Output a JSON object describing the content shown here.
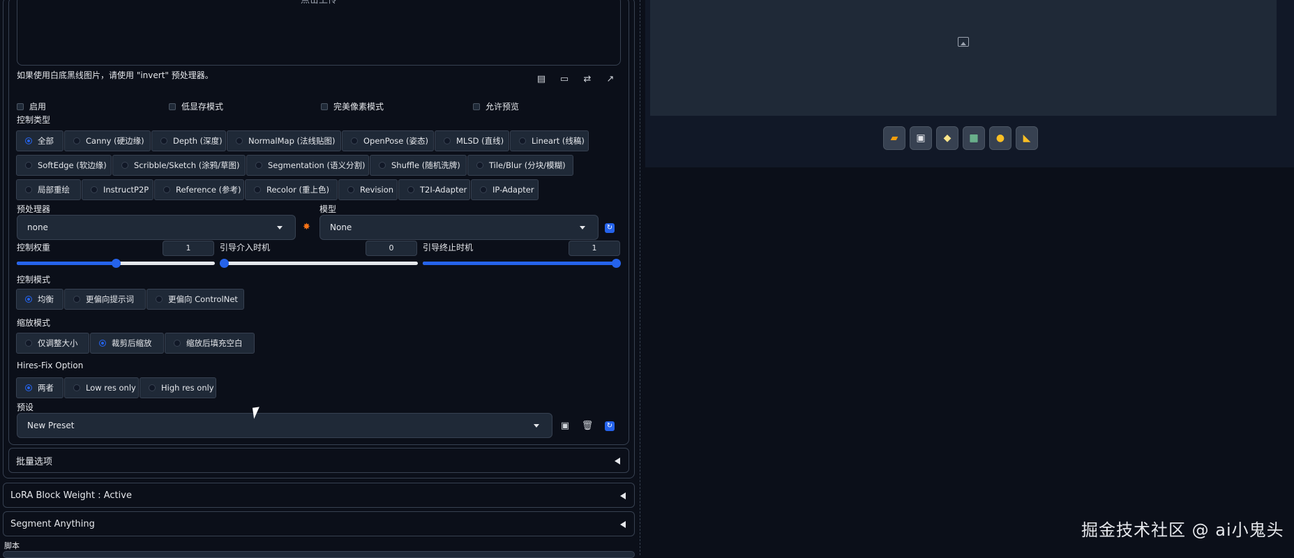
{
  "upload": {
    "text": "点击上传",
    "hint": "如果使用白底黑线图片，请使用 \"invert\" 预处理器。"
  },
  "checkboxes": [
    "启用",
    "低显存模式",
    "完美像素模式",
    "允许预览"
  ],
  "control_type": {
    "label": "控制类型",
    "rows": [
      [
        "全部",
        "Canny (硬边缘)",
        "Depth (深度)",
        "NormalMap (法线贴图)",
        "OpenPose (姿态)",
        "MLSD (直线)",
        "Lineart (线稿)"
      ],
      [
        "SoftEdge (软边缘)",
        "Scribble/Sketch (涂鸦/草图)",
        "Segmentation (语义分割)",
        "Shuffle (随机洗牌)",
        "Tile/Blur (分块/模糊)"
      ],
      [
        "局部重绘",
        "InstructP2P",
        "Reference (参考)",
        "Recolor (重上色)",
        "Revision",
        "T2I-Adapter",
        "IP-Adapter"
      ]
    ],
    "selected": "全部"
  },
  "preprocessor": {
    "label": "预处理器",
    "value": "none"
  },
  "model": {
    "label": "模型",
    "value": "None"
  },
  "control_weight": {
    "label": "控制权重",
    "value": "1",
    "fraction": 0.5
  },
  "start_step": {
    "label": "引导介入时机",
    "value": "0",
    "fraction": 0.0
  },
  "end_step": {
    "label": "引导终止时机",
    "value": "1",
    "fraction": 1.0
  },
  "control_mode": {
    "label": "控制模式",
    "options": [
      "均衡",
      "更偏向提示词",
      "更偏向 ControlNet"
    ],
    "selected": "均衡"
  },
  "resize_mode": {
    "label": "缩放模式",
    "options": [
      "仅调整大小",
      "裁剪后缩放",
      "缩放后填充空白"
    ],
    "selected": "裁剪后缩放"
  },
  "hires_fix": {
    "label": "Hires-Fix Option",
    "options": [
      "两者",
      "Low res only",
      "High res only"
    ],
    "selected": "两者"
  },
  "preset": {
    "label": "预设",
    "value": "New Preset"
  },
  "accordions": {
    "batch": "批量选项",
    "lora": "LoRA Block Weight : Active",
    "segment": "Segment Anything",
    "script": "脚本"
  },
  "watermark": "掘金技术社区 @ ai小鬼头",
  "colors": {
    "accent": "#2563eb",
    "background": "#0b0f19",
    "panel": "#1f2937"
  }
}
